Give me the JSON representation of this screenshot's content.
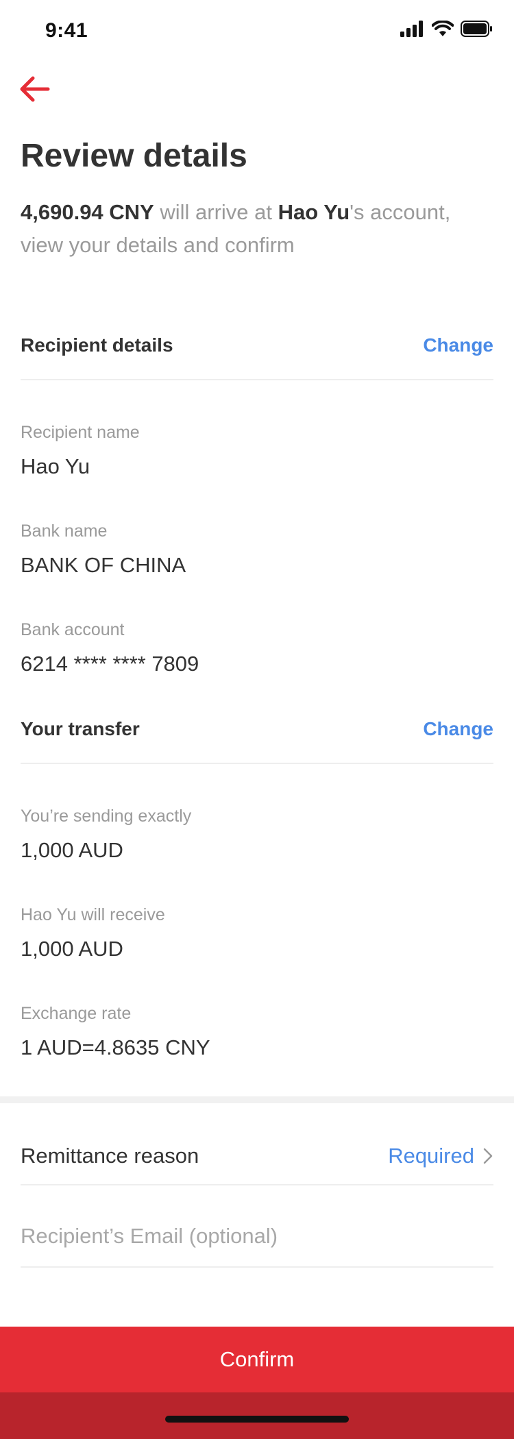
{
  "status_bar": {
    "time": "9:41"
  },
  "header": {
    "title": "Review details",
    "subtitle": {
      "amount": "4,690.94 CNY",
      "text1": " will arrive at ",
      "recipient": "Hao Yu",
      "text2": "'s account, view your  details and confirm"
    }
  },
  "recipient_section": {
    "title": "Recipient details",
    "change_label": "Change",
    "fields": [
      {
        "label": "Recipient name",
        "value": "Hao Yu"
      },
      {
        "label": "Bank name",
        "value": "BANK OF CHINA"
      },
      {
        "label": "Bank account",
        "value": "6214 **** **** 7809"
      }
    ]
  },
  "transfer_section": {
    "title": "Your transfer",
    "change_label": "Change",
    "fields": [
      {
        "label": "You’re sending exactly",
        "value": "1,000 AUD"
      },
      {
        "label": "Hao Yu will receive",
        "value": "1,000 AUD"
      },
      {
        "label": "Exchange rate",
        "value": "1 AUD=4.8635 CNY"
      }
    ]
  },
  "remittance": {
    "label": "Remittance reason",
    "value": "Required"
  },
  "email": {
    "placeholder": "Recipient’s Email (optional)",
    "value": ""
  },
  "confirm_label": "Confirm",
  "colors": {
    "accent": "#e52d36",
    "link": "#4a8ae6",
    "home_area": "#b8242c"
  }
}
